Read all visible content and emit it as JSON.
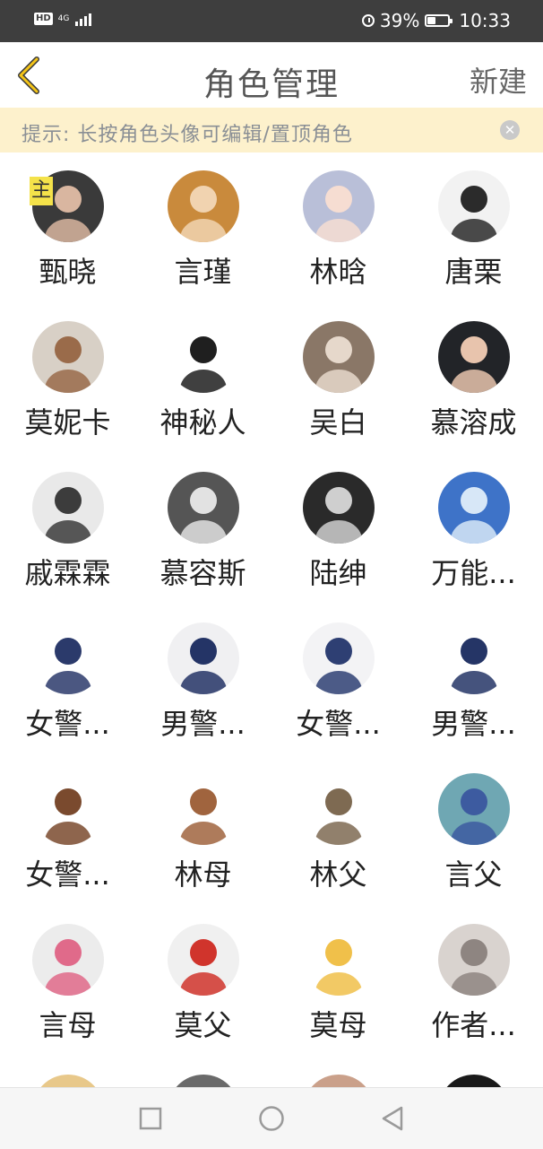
{
  "status_bar": {
    "hd": "HD",
    "network": "4G",
    "battery": "39%",
    "battery_level": 0.39,
    "time": "10:33"
  },
  "header": {
    "back_icon": "chevron-left-icon",
    "title": "角色管理",
    "new_label": "新建",
    "accent": "#f5c518"
  },
  "tip": {
    "text": "提示: 长按角色头像可编辑/置顶角色",
    "close_icon": "close-icon",
    "bg": "#fdf1cc"
  },
  "characters": [
    {
      "name": "甄晓",
      "badge": "主",
      "palette": [
        "#3a3a3a",
        "#d9b6a0"
      ]
    },
    {
      "name": "言瑾",
      "badge": "",
      "palette": [
        "#c98a3c",
        "#f1d3b0"
      ]
    },
    {
      "name": "林晗",
      "badge": "",
      "palette": [
        "#b9bfd8",
        "#f6ddd2"
      ]
    },
    {
      "name": "唐栗",
      "badge": "",
      "palette": [
        "#f2f2f2",
        "#2b2b2b"
      ]
    },
    {
      "name": "莫妮卡",
      "badge": "",
      "palette": [
        "#d8d0c6",
        "#9a6b4a"
      ]
    },
    {
      "name": "神秘人",
      "badge": "",
      "palette": [
        "#ffffff",
        "#1f1f1f"
      ]
    },
    {
      "name": "吴白",
      "badge": "",
      "palette": [
        "#8a7767",
        "#e6d8cb"
      ]
    },
    {
      "name": "慕溶成",
      "badge": "",
      "palette": [
        "#222428",
        "#e8c4ad"
      ]
    },
    {
      "name": "戚霖霖",
      "badge": "",
      "palette": [
        "#e9e9e9",
        "#3c3c3c"
      ]
    },
    {
      "name": "慕容斯",
      "badge": "",
      "palette": [
        "#555555",
        "#e2e2e2"
      ]
    },
    {
      "name": "陆绅",
      "badge": "",
      "palette": [
        "#2a2a2a",
        "#cfcfcf"
      ]
    },
    {
      "name": "万能...",
      "badge": "",
      "palette": [
        "#3e73c8",
        "#d7e7f7"
      ]
    },
    {
      "name": "女警...",
      "badge": "",
      "palette": [
        "#ffffff",
        "#2b3a6b"
      ]
    },
    {
      "name": "男警...",
      "badge": "",
      "palette": [
        "#f0f0f2",
        "#243466"
      ]
    },
    {
      "name": "女警...",
      "badge": "",
      "palette": [
        "#f3f3f5",
        "#2e3f73"
      ]
    },
    {
      "name": "男警...",
      "badge": "",
      "palette": [
        "#ffffff",
        "#253566"
      ]
    },
    {
      "name": "女警...",
      "badge": "",
      "palette": [
        "#ffffff",
        "#7a4a2e"
      ]
    },
    {
      "name": "林母",
      "badge": "",
      "palette": [
        "#ffffff",
        "#a0643e"
      ]
    },
    {
      "name": "林父",
      "badge": "",
      "palette": [
        "#ffffff",
        "#7e6a52"
      ]
    },
    {
      "name": "言父",
      "badge": "",
      "palette": [
        "#6fa7b3",
        "#3d5ba0"
      ]
    },
    {
      "name": "言母",
      "badge": "",
      "palette": [
        "#ececec",
        "#e06a8a"
      ]
    },
    {
      "name": "莫父",
      "badge": "",
      "palette": [
        "#f0f0f0",
        "#d0342c"
      ]
    },
    {
      "name": "莫母",
      "badge": "",
      "palette": [
        "#ffffff",
        "#f0c04a"
      ]
    },
    {
      "name": "作者...",
      "badge": "",
      "palette": [
        "#d9d3cf",
        "#8e8581"
      ]
    }
  ],
  "partial_row": [
    {
      "palette": [
        "#e8c88a",
        "#f5eee0"
      ]
    },
    {
      "palette": [
        "#6a6a6a",
        "#efe8e0"
      ]
    },
    {
      "palette": [
        "#caa08a",
        "#f4ece6"
      ]
    },
    {
      "palette": [
        "#1a1a1a",
        "#5a5a5a"
      ]
    }
  ],
  "nav_bar": {
    "recents_icon": "square-recents-icon",
    "home_icon": "circle-home-icon",
    "back_icon": "triangle-back-icon"
  }
}
